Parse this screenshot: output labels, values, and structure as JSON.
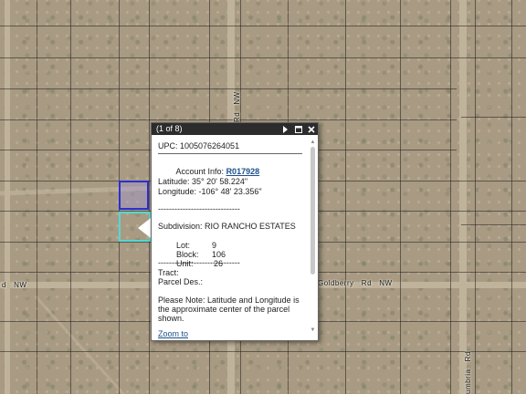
{
  "roads": {
    "west_label": "d   NW",
    "goldberry_label": "Goldberry   Rd   NW",
    "vertical_label": "Rd   NW",
    "bottom_right_label": "umbria   Rd"
  },
  "popup": {
    "counter": "(1 of 8)",
    "upc": "UPC: 1005076264051",
    "account_label": "Account Info: ",
    "account_value": "R017928",
    "latitude": "Latitude: 35° 20' 58.224\"",
    "longitude": "Longitude: -106° 48' 23.356\"",
    "dashes1": "------------------------------",
    "subdivision": "Subdivision: RIO RANCHO ESTATES",
    "lot_label": "Lot:",
    "lot_value": "9",
    "block_label": "Block:",
    "block_value": "106",
    "unit_label": "Unit:",
    "unit_value": "26",
    "dashes2": "------------------------------",
    "tract": "Tract:",
    "parcel": "Parcel Des.:",
    "note1": "Please Note: Latitude and Longitude is",
    "note2": "the approximate center of the parcel",
    "note3": "shown.",
    "zoom_link": "Zoom to"
  },
  "icons": [
    "next-arrow-icon",
    "maximize-icon",
    "close-icon",
    "scroll-up-icon",
    "scroll-down-icon"
  ]
}
